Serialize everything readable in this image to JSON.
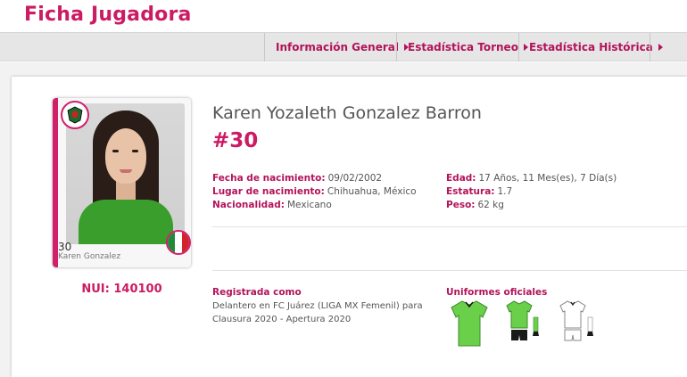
{
  "page": {
    "title": "Ficha Jugadora"
  },
  "tabs": [
    {
      "label": "Información General"
    },
    {
      "label": "Estadística Torneo"
    },
    {
      "label": "Estadística Histórica"
    }
  ],
  "photo_card": {
    "number": "30",
    "name": "Karen Gonzalez"
  },
  "player": {
    "full_name": "Karen Yozaleth Gonzalez Barron",
    "number": "#30",
    "nui": "NUI: 140100"
  },
  "info_left": [
    {
      "label": "Fecha de nacimiento:",
      "value": "09/02/2002"
    },
    {
      "label": "Lugar de nacimiento:",
      "value": "Chihuahua, México"
    },
    {
      "label": "Nacionalidad:",
      "value": "Mexicano"
    }
  ],
  "info_right": [
    {
      "label": "Edad:",
      "value": "17 Años, 11 Mes(es), 7 Día(s)"
    },
    {
      "label": "Estatura:",
      "value": "1.7"
    },
    {
      "label": "Peso:",
      "value": "62 kg"
    }
  ],
  "registered": {
    "title": "Registrada como",
    "text": "Delantero en FC Juárez (LIGA MX Femenil) para Clausura 2020 - Apertura 2020"
  },
  "uniforms": {
    "title": "Uniformes oficiales"
  },
  "icons": {
    "club": "club-crest-icon",
    "flag": "mexico-flag-icon",
    "caret": "caret-right-icon"
  },
  "colors": {
    "accent": "#cc1a63",
    "tabbar": "#e6e6e6",
    "kit_green": "#6ad04a"
  }
}
